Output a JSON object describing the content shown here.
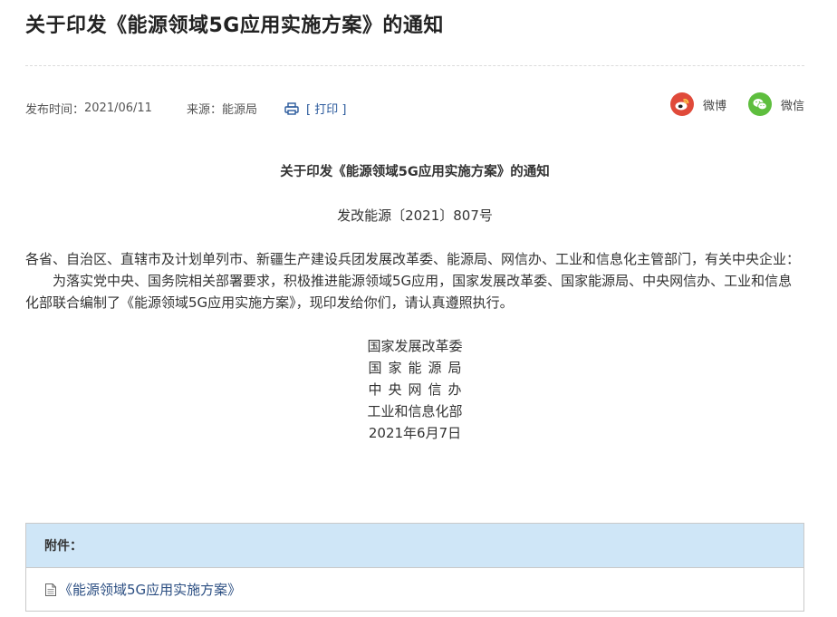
{
  "header": {
    "title": "关于印发《能源领域5G应用实施方案》的通知"
  },
  "meta": {
    "publish_label": "发布时间：",
    "publish_date": "2021/06/11",
    "source_label": "来源：",
    "source_value": "能源局",
    "print_label": "[ 打印 ]"
  },
  "share": {
    "weibo_label": "微博",
    "wechat_label": "微信",
    "weibo_icon": "weibo-icon",
    "wechat_icon": "wechat-icon",
    "colors": {
      "weibo": "#e04a3a",
      "wechat": "#5ebe3e"
    }
  },
  "article": {
    "title": "关于印发《能源领域5G应用实施方案》的通知",
    "doc_number": "发改能源〔2021〕807号",
    "salutation": "各省、自治区、直辖市及计划单列市、新疆生产建设兵团发展改革委、能源局、网信办、工业和信息化主管部门，有关中央企业：",
    "body": "为落实党中央、国务院相关部署要求，积极推进能源领域5G应用，国家发展改革委、国家能源局、中央网信办、工业和信息化部联合编制了《能源领域5G应用实施方案》，现印发给你们，请认真遵照执行。",
    "signatories": [
      "国家发展改革委",
      "国家能源局",
      "中央网信办",
      "工业和信息化部"
    ],
    "date": "2021年6月7日"
  },
  "attachments": {
    "header": "附件：",
    "items": [
      {
        "label": "《能源领域5G应用实施方案》",
        "icon": "document-icon"
      }
    ]
  },
  "colors": {
    "link": "#2b4e82",
    "attachment_header_bg": "#cfe6f7"
  }
}
